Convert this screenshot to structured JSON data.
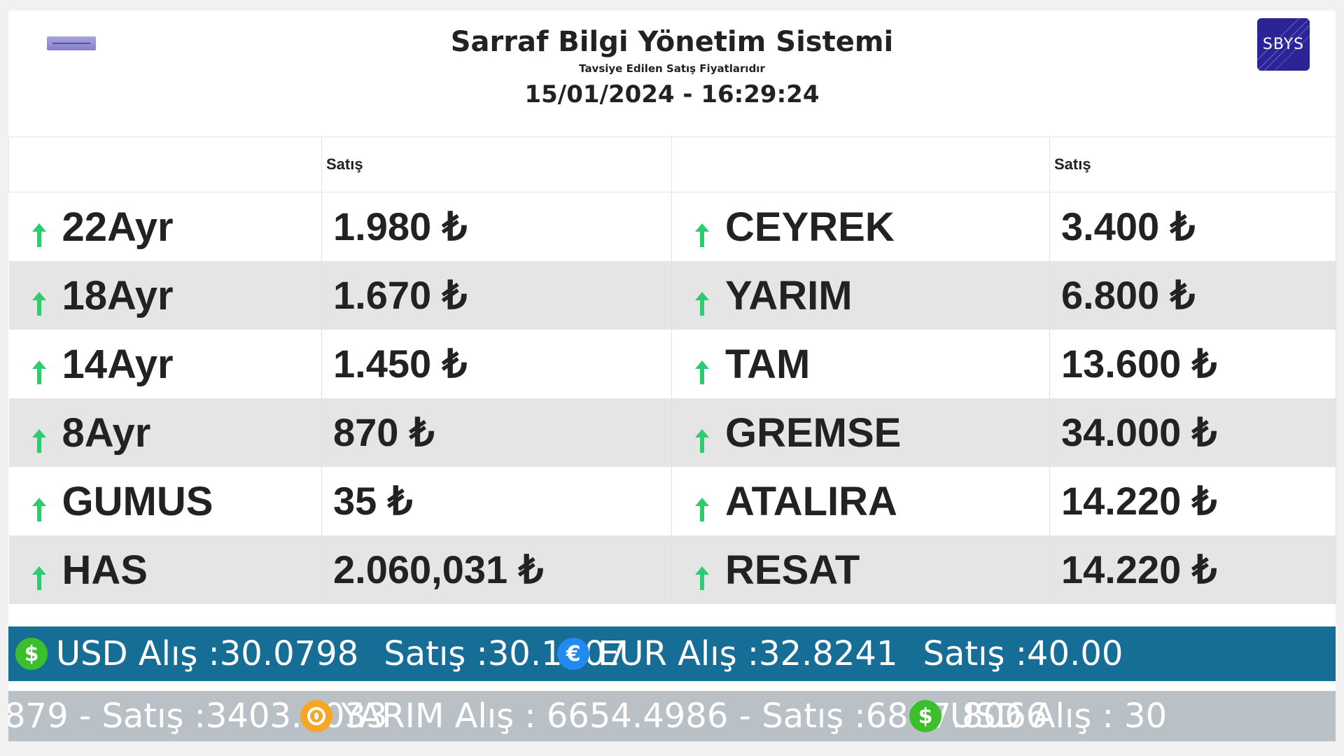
{
  "header": {
    "title": "Sarraf Bilgi Yönetim Sistemi",
    "subtitle": "Tavsiye Edilen Satış Fiyatlarıdır",
    "datetime": "15/01/2024 - 16:29:24",
    "logo_right_text": "SBYS"
  },
  "table": {
    "col_header_left": "Satış",
    "col_header_right": "Satış",
    "trend_icon": "arrow-up-icon",
    "trend_color": "#2ecc71",
    "rows": [
      {
        "left_name": "22Ayr",
        "left_value": "1.980 ₺",
        "right_name": "CEYREK",
        "right_value": "3.400 ₺"
      },
      {
        "left_name": "18Ayr",
        "left_value": "1.670 ₺",
        "right_name": "YARIM",
        "right_value": "6.800 ₺"
      },
      {
        "left_name": "14Ayr",
        "left_value": "1.450 ₺",
        "right_name": "TAM",
        "right_value": "13.600 ₺"
      },
      {
        "left_name": "8Ayr",
        "left_value": "870 ₺",
        "right_name": "GREMSE",
        "right_value": "34.000 ₺"
      },
      {
        "left_name": "GUMUS",
        "left_value": "35 ₺",
        "right_name": "ATALIRA",
        "right_value": "14.220 ₺"
      },
      {
        "left_name": "HAS",
        "left_value": "2.060,031 ₺",
        "right_name": "RESAT",
        "right_value": "14.220 ₺"
      }
    ]
  },
  "ticker_currency": {
    "background": "#166d96",
    "items": [
      {
        "icon": "dollar-icon",
        "symbol": "$",
        "buy": "USD Alış :30.0798",
        "sell": "Satış :30.1707"
      },
      {
        "icon": "euro-icon",
        "symbol": "€",
        "buy": "EUR Alış :32.8241",
        "sell": "Satış :40.00"
      }
    ]
  },
  "ticker_gold": {
    "background": "#b9c1c6",
    "items": [
      {
        "icon": "",
        "text": "879 - Satış :3403.9033"
      },
      {
        "icon": "gold-coin-icon",
        "text": "YARIM Alış : 6654.4986 - Satış :6807.8066"
      },
      {
        "icon": "dollar-icon",
        "symbol": "$",
        "text": "USD Alış : 30"
      }
    ]
  }
}
